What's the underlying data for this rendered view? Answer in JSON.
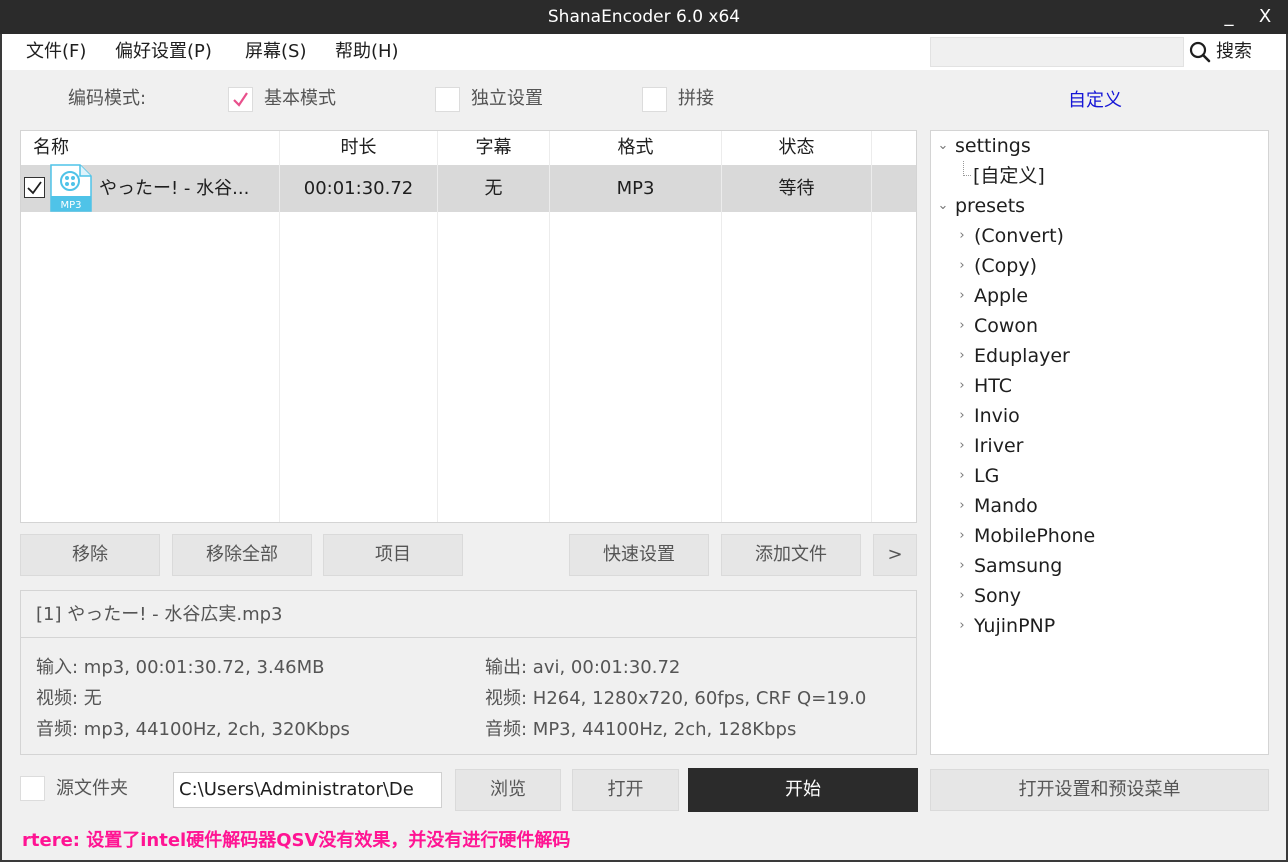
{
  "window": {
    "title": "ShanaEncoder 6.0 x64",
    "minimize": "_",
    "close": "X"
  },
  "menu": {
    "items": [
      "文件(F)",
      "偏好设置(P)",
      "屏幕(S)",
      "帮助(H)"
    ],
    "search_value": "",
    "search_label": "搜索"
  },
  "mode": {
    "label": "编码模式:",
    "options": [
      {
        "label": "基本模式",
        "checked": true
      },
      {
        "label": "独立设置",
        "checked": false
      },
      {
        "label": "拼接",
        "checked": false
      }
    ],
    "custom_link": "自定义"
  },
  "file_list": {
    "columns": [
      "名称",
      "时长",
      "字幕",
      "格式",
      "状态"
    ],
    "rows": [
      {
        "checked": true,
        "icon_label": "MP3",
        "name": "やったー! - 水谷...",
        "duration": "00:01:30.72",
        "subtitle": "无",
        "format": "MP3",
        "status": "等待"
      }
    ]
  },
  "buttons": {
    "remove": "移除",
    "remove_all": "移除全部",
    "item": "项目",
    "quick_settings": "快速设置",
    "add_file": "添加文件",
    "more": ">"
  },
  "info": {
    "title": "[1] やったー! - 水谷広実.mp3",
    "input": "输入:  mp3, 00:01:30.72, 3.46MB",
    "input_video": "视频:  无",
    "input_audio": "音频:  mp3, 44100Hz, 2ch, 320Kbps",
    "output": "输出:  avi, 00:01:30.72",
    "output_video": "视频:  H264, 1280x720, 60fps, CRF Q=19.0",
    "output_audio": "音频:  MP3, 44100Hz, 2ch, 128Kbps"
  },
  "tree": {
    "settings": {
      "label": "settings",
      "children": [
        "[自定义]"
      ]
    },
    "presets": {
      "label": "presets",
      "children": [
        "(Convert)",
        "(Copy)",
        "Apple",
        "Cowon",
        "Eduplayer",
        "HTC",
        "Invio",
        "Iriver",
        "LG",
        "Mando",
        "MobilePhone",
        "Samsung",
        "Sony",
        "YujinPNP"
      ]
    }
  },
  "bottom": {
    "source_folder_label": "源文件夹",
    "source_folder_checked": false,
    "path": "C:\\Users\\Administrator\\De",
    "browse": "浏览",
    "open": "打开",
    "start": "开始",
    "open_settings": "打开设置和预设菜单"
  },
  "status": {
    "text": "rtere: 设置了intel硬件解码器QSV没有效果，并没有进行硬件解码",
    "color": "#ff1493"
  },
  "colors": {
    "titlebar": "#2b2b2b",
    "accent_link": "#1515d6",
    "check_pink": "#e8508c",
    "selected_row": "#d9d9d9",
    "file_icon": "#4fc3e8"
  }
}
